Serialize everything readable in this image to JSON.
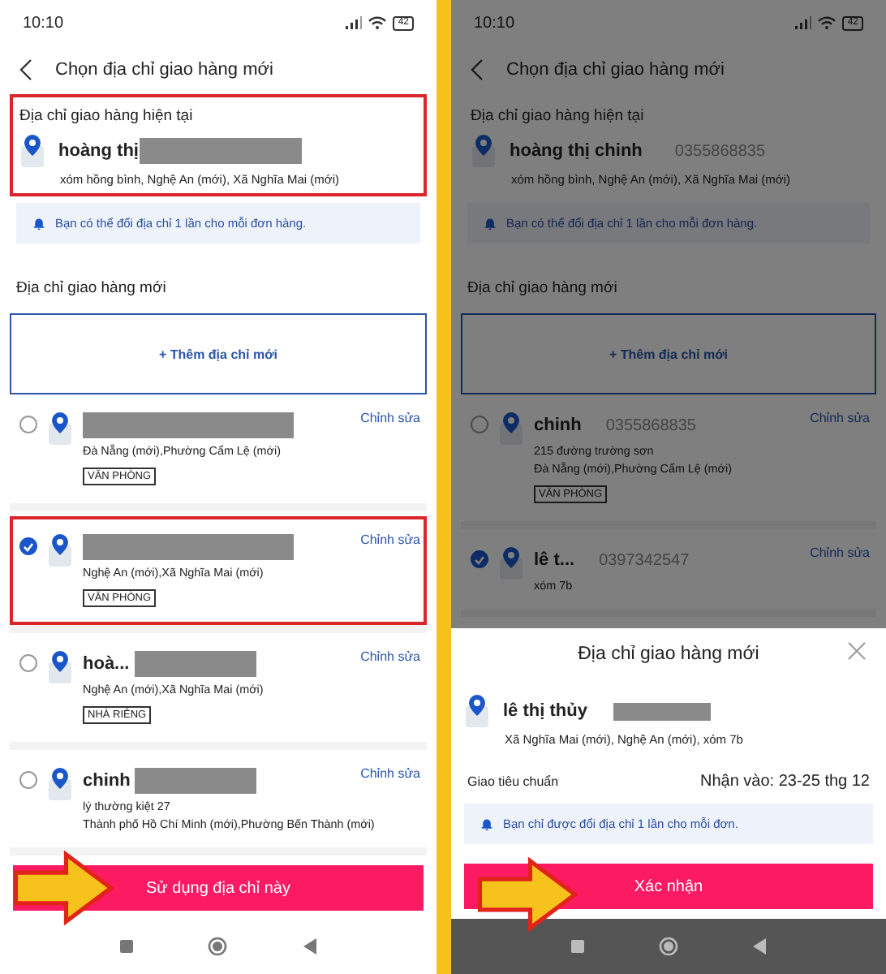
{
  "screens": [
    {
      "status_bar": {
        "time": "10:10",
        "battery": "42"
      },
      "header": {
        "title": "Chọn địa chỉ giao hàng mới"
      },
      "current_address": {
        "label": "Địa chỉ giao hàng hiện tại",
        "name": "hoàng thị",
        "redacted": true,
        "address": "xóm hồng bình, Nghệ An (mới), Xã Nghĩa Mai (mới)",
        "highlighted": true
      },
      "notice": "Bạn có thể đổi địa chỉ 1 lần cho mỗi đơn hàng.",
      "new_address_label": "Địa chỉ giao hàng mới",
      "add_button": "+ Thêm địa chỉ mới",
      "addresses": [
        {
          "selected": false,
          "redacted": true,
          "lines": [
            "Đà Nẵng (mới),Phường Cẩm Lệ (mới)"
          ],
          "tag": "VĂN PHÒNG",
          "edit": "Chỉnh sửa"
        },
        {
          "selected": true,
          "highlighted": true,
          "redacted": true,
          "lines": [
            "Nghệ An (mới),Xã Nghĩa Mai (mới)"
          ],
          "tag": "VĂN PHÒNG",
          "edit": "Chỉnh sửa"
        },
        {
          "selected": false,
          "name": "hoà...",
          "redacted": true,
          "lines": [
            "Nghệ An (mới),Xã Nghĩa Mai (mới)"
          ],
          "tag": "NHÀ RIÊNG",
          "edit": "Chỉnh sửa"
        },
        {
          "selected": false,
          "name": "chinh",
          "redacted": true,
          "lines": [
            "lý thường kiệt 27",
            "Thành phố Hồ Chí Minh (mới),Phường Bến Thành (mới)"
          ],
          "edit": "Chỉnh sửa"
        }
      ],
      "action_button": {
        "label": "Sử dụng địa chỉ này",
        "arrow": true
      }
    },
    {
      "dimmed": true,
      "status_bar": {
        "time": "10:10",
        "battery": "42"
      },
      "header": {
        "title": "Chọn địa chỉ giao hàng mới"
      },
      "current_address": {
        "label": "Địa chỉ giao hàng hiện tại",
        "name": "hoàng thị chinh",
        "phone": "0355868835",
        "address": "xóm hồng bình, Nghệ An (mới), Xã Nghĩa Mai (mới)"
      },
      "notice": "Bạn có thể đổi địa chỉ 1 lần cho mỗi đơn hàng.",
      "new_address_label": "Địa chỉ giao hàng mới",
      "add_button": "+ Thêm địa chỉ mới",
      "addresses": [
        {
          "selected": false,
          "name": "chinh",
          "phone": "0355868835",
          "lines": [
            "215 đường trường sơn",
            "Đà Nẵng (mới),Phường Cẩm Lệ (mới)"
          ],
          "tag": "VĂN PHÒNG",
          "edit": "Chỉnh sửa"
        },
        {
          "selected": true,
          "name": "lê t...",
          "phone": "0397342547",
          "lines": [
            "xóm 7b"
          ],
          "edit": "Chỉnh sửa"
        }
      ],
      "sheet": {
        "title": "Địa chỉ giao hàng mới",
        "name": "lê thị thủy",
        "redacted": true,
        "address": "Xã Nghĩa Mai (mới), Nghệ An (mới), xóm 7b",
        "delivery": "Giao tiêu chuẩn",
        "eta": "Nhận vào: 23-25 thg 12",
        "notice": "Bạn chỉ được đổi địa chỉ 1 lần cho mỗi đơn.",
        "button": {
          "label": "Xác nhận",
          "arrow": true
        }
      }
    }
  ]
}
